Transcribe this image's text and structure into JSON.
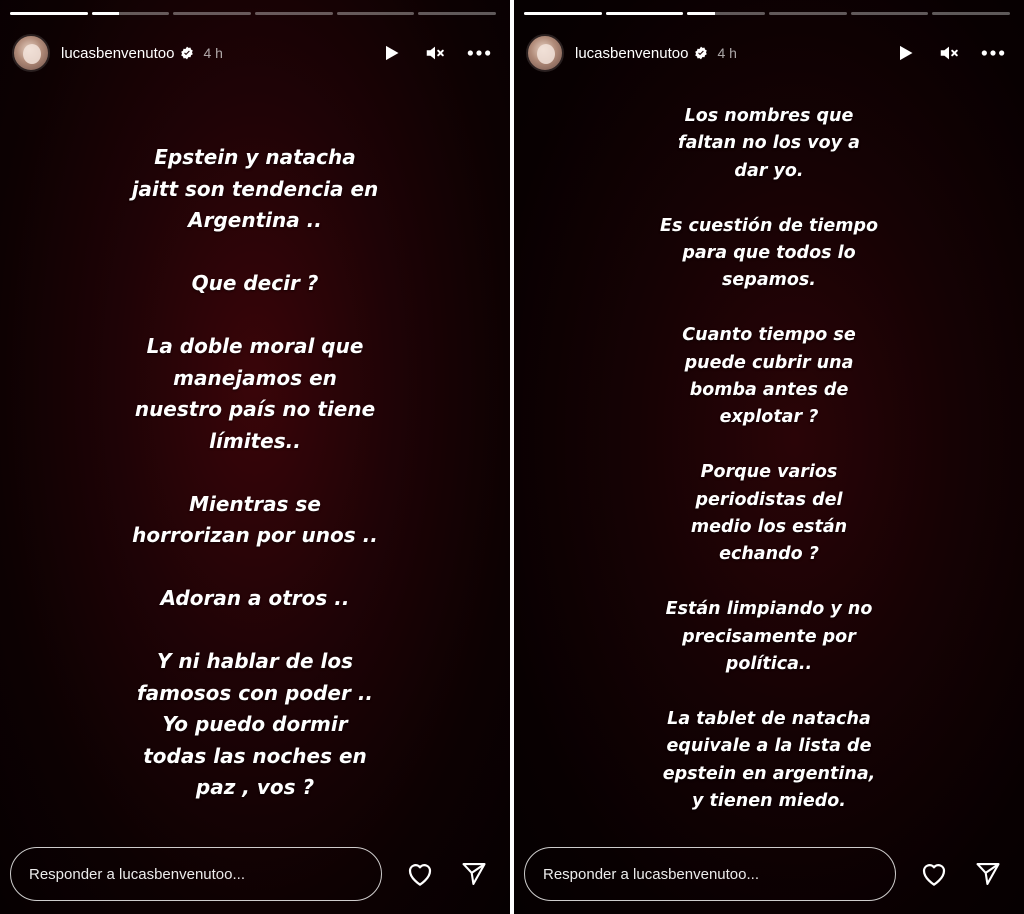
{
  "stories": [
    {
      "progress": [
        1,
        0,
        0,
        0,
        0,
        0
      ],
      "active_progress": 0.35,
      "username": "lucasbenvenutoo",
      "time": "4 h",
      "icons": {
        "play": "play-icon",
        "mute": "mute-icon",
        "more": "more-icon",
        "like": "heart-icon",
        "share": "send-icon",
        "verified": "verified-badge-icon"
      },
      "paragraphs": [
        "Epstein y natacha\njaitt son tendencia en\nArgentina ..",
        "Que decir ?",
        "La doble moral que\nmanejamos en\nnuestro país no tiene\nlímites..",
        "Mientras se\nhorrorizan por unos ..",
        "Adoran a otros ..",
        "Y ni hablar de los\nfamosos con poder ..\nYo puedo dormir\ntodas las noches en\npaz , vos ?"
      ],
      "reply_placeholder": "Responder a lucasbenvenutoo..."
    },
    {
      "progress": [
        1,
        1,
        0,
        0,
        0,
        0
      ],
      "active_progress": 0.35,
      "username": "lucasbenvenutoo",
      "time": "4 h",
      "icons": {
        "play": "play-icon",
        "mute": "mute-icon",
        "more": "more-icon",
        "like": "heart-icon",
        "share": "send-icon",
        "verified": "verified-badge-icon"
      },
      "paragraphs": [
        "Los nombres que\nfaltan no los voy a\ndar yo.",
        "Es cuestión de tiempo\npara que todos lo\nsepamos.",
        "Cuanto tiempo se\npuede cubrir una\nbomba antes de\nexplotar ?",
        "Porque varios\nperiodistas del\nmedio los están\nechando ?",
        "Están limpiando y no\nprecisamente por\npolítica..",
        "La tablet de natacha\nequivale a la lista de\nepstein en argentina,\ny tienen miedo."
      ],
      "reply_placeholder": "Responder a lucasbenvenutoo..."
    }
  ],
  "colors": {
    "text": "#ffffff",
    "background_dark": "#0d0102",
    "background_red": "#3a0509",
    "verified": "#ffffff"
  }
}
